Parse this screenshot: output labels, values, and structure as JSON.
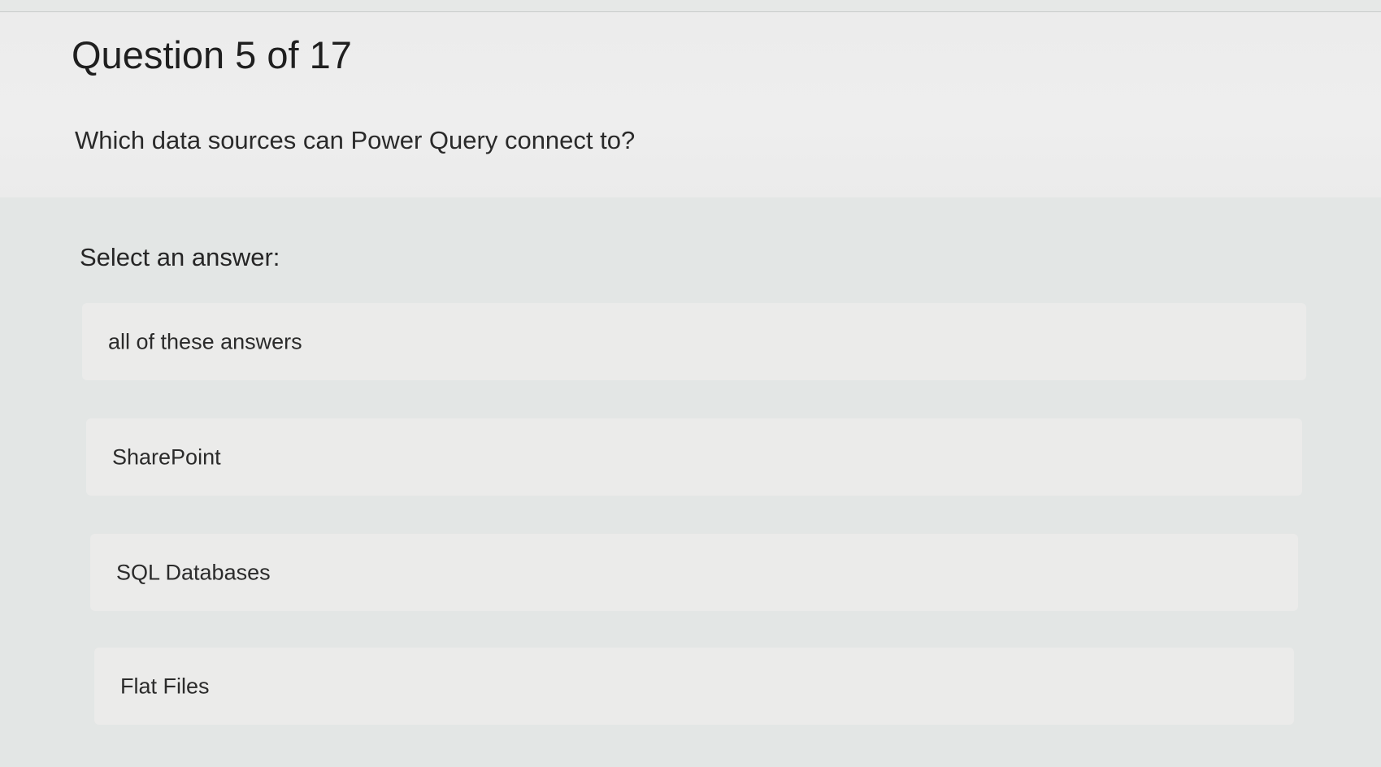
{
  "question": {
    "counter": "Question 5 of 17",
    "text": "Which data sources can Power Query connect to?"
  },
  "answers": {
    "prompt": "Select an answer:",
    "options": [
      {
        "label": "all of these answers"
      },
      {
        "label": "SharePoint"
      },
      {
        "label": "SQL Databases"
      },
      {
        "label": "Flat Files"
      }
    ]
  },
  "colors": {
    "header_background": "#ececec",
    "section_background": "#e3e6e5",
    "option_background": "#ebebea",
    "text": "#262626"
  }
}
